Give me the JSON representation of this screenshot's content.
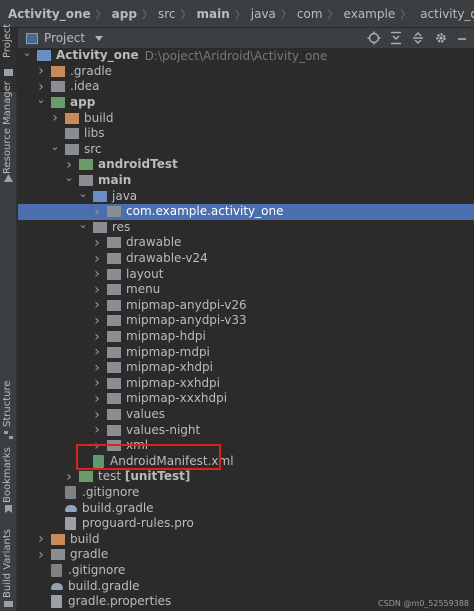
{
  "breadcrumb": [
    {
      "label": "Activity_one",
      "bold": true,
      "folder": false
    },
    {
      "label": "app",
      "bold": true,
      "folder": false
    },
    {
      "label": "src",
      "bold": false,
      "folder": false
    },
    {
      "label": "main",
      "bold": true,
      "folder": false
    },
    {
      "label": "java",
      "bold": false,
      "folder": false
    },
    {
      "label": "com",
      "bold": false,
      "folder": false
    },
    {
      "label": "example",
      "bold": false,
      "folder": false
    },
    {
      "label": "activity_one",
      "bold": false,
      "folder": true
    }
  ],
  "breadcrumb_separator": "〉",
  "left_strip": {
    "project": "Project",
    "resource_manager": "Resource Manager",
    "structure": "Structure",
    "bookmarks": "Bookmarks",
    "build_variants": "Build Variants"
  },
  "project_view": {
    "title": "Project",
    "tools": [
      "locate-icon",
      "collapse-all-icon",
      "expand-all-icon",
      "gear-icon",
      "minimize-icon"
    ]
  },
  "tree": [
    {
      "label": "Activity_one",
      "path": "D:\\poject\\Aridroid\\Activity_one",
      "depth": 0,
      "expanded": true,
      "icon": "folder-blue",
      "bold": true
    },
    {
      "label": ".gradle",
      "depth": 1,
      "expanded": false,
      "icon": "folder-orange"
    },
    {
      "label": ".idea",
      "depth": 1,
      "expanded": false,
      "icon": "folder-gray"
    },
    {
      "label": "app",
      "depth": 1,
      "expanded": true,
      "icon": "folder-green",
      "bold": true
    },
    {
      "label": "build",
      "depth": 2,
      "expanded": false,
      "icon": "folder-orange"
    },
    {
      "label": "libs",
      "depth": 2,
      "leaf": true,
      "icon": "folder-gray"
    },
    {
      "label": "src",
      "depth": 2,
      "expanded": true,
      "icon": "folder-gray"
    },
    {
      "label": "androidTest",
      "depth": 3,
      "expanded": false,
      "icon": "folder-green",
      "bold": true
    },
    {
      "label": "main",
      "depth": 3,
      "expanded": true,
      "icon": "folder-gray",
      "bold": true
    },
    {
      "label": "java",
      "depth": 4,
      "expanded": true,
      "icon": "folder-blue"
    },
    {
      "label": "com.example.activity_one",
      "depth": 5,
      "expanded": false,
      "icon": "folder-gray",
      "selected": true
    },
    {
      "label": "res",
      "depth": 4,
      "expanded": true,
      "icon": "folder-gray"
    },
    {
      "label": "drawable",
      "depth": 5,
      "expanded": false,
      "icon": "folder-gray"
    },
    {
      "label": "drawable-v24",
      "depth": 5,
      "expanded": false,
      "icon": "folder-gray"
    },
    {
      "label": "layout",
      "depth": 5,
      "expanded": false,
      "icon": "folder-gray"
    },
    {
      "label": "menu",
      "depth": 5,
      "expanded": false,
      "icon": "folder-gray"
    },
    {
      "label": "mipmap-anydpi-v26",
      "depth": 5,
      "expanded": false,
      "icon": "folder-gray"
    },
    {
      "label": "mipmap-anydpi-v33",
      "depth": 5,
      "expanded": false,
      "icon": "folder-gray"
    },
    {
      "label": "mipmap-hdpi",
      "depth": 5,
      "expanded": false,
      "icon": "folder-gray"
    },
    {
      "label": "mipmap-mdpi",
      "depth": 5,
      "expanded": false,
      "icon": "folder-gray"
    },
    {
      "label": "mipmap-xhdpi",
      "depth": 5,
      "expanded": false,
      "icon": "folder-gray"
    },
    {
      "label": "mipmap-xxhdpi",
      "depth": 5,
      "expanded": false,
      "icon": "folder-gray"
    },
    {
      "label": "mipmap-xxxhdpi",
      "depth": 5,
      "expanded": false,
      "icon": "folder-gray"
    },
    {
      "label": "values",
      "depth": 5,
      "expanded": false,
      "icon": "folder-gray"
    },
    {
      "label": "values-night",
      "depth": 5,
      "expanded": false,
      "icon": "folder-gray"
    },
    {
      "label": "xml",
      "depth": 5,
      "expanded": false,
      "icon": "folder-gray"
    },
    {
      "label": "AndroidManifest.xml",
      "depth": 4,
      "leaf": true,
      "icon": "manifest"
    },
    {
      "label": "test [unitTest]",
      "depth": 3,
      "expanded": false,
      "icon": "folder-green",
      "bold_suffix": "[unitTest]"
    },
    {
      "label": ".gitignore",
      "depth": 2,
      "leaf": true,
      "icon": "gitignore"
    },
    {
      "label": "build.gradle",
      "depth": 2,
      "leaf": true,
      "icon": "gradle"
    },
    {
      "label": "proguard-rules.pro",
      "depth": 2,
      "leaf": true,
      "icon": "pro"
    },
    {
      "label": "build",
      "depth": 1,
      "expanded": false,
      "icon": "folder-orange"
    },
    {
      "label": "gradle",
      "depth": 1,
      "expanded": false,
      "icon": "folder-gray"
    },
    {
      "label": ".gitignore",
      "depth": 1,
      "leaf": true,
      "icon": "gitignore"
    },
    {
      "label": "build.gradle",
      "depth": 1,
      "leaf": true,
      "icon": "gradle"
    },
    {
      "label": "gradle.properties",
      "depth": 1,
      "leaf": true,
      "icon": "props"
    }
  ],
  "watermark": "CSDN @m0_52559388",
  "colors": {
    "background": "#2b2b2b",
    "panel": "#3c3f41",
    "selection": "#4b6eaf",
    "highlight": "#e0201e",
    "text": "#bbbbbb"
  }
}
